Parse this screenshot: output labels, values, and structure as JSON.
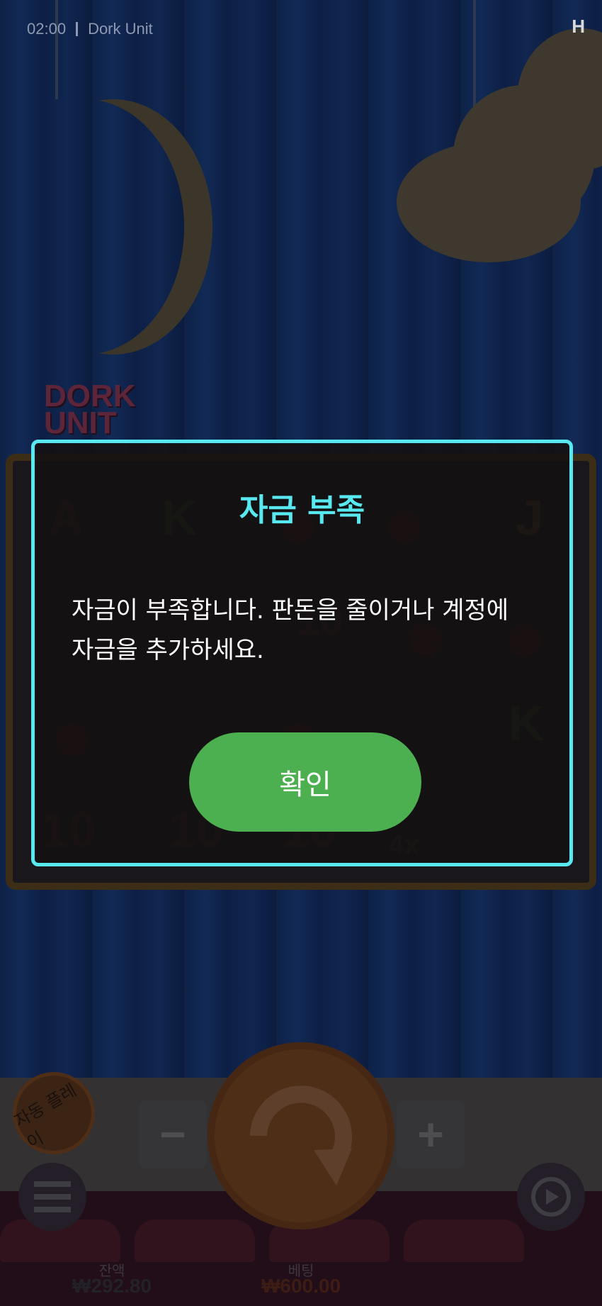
{
  "status_bar": {
    "time": "02:00",
    "game_name": "Dork Unit"
  },
  "game": {
    "logo_text": "DORK UNIT",
    "reel_symbols": [
      "A",
      "K",
      "J",
      "10",
      "K",
      "10",
      "10",
      "10",
      "4x"
    ]
  },
  "dialog": {
    "title": "자금 부족",
    "message": "자금이 부족합니다. 판돈을 줄이거나 계정에 자금을 추가하세요.",
    "ok_label": "확인"
  },
  "controls": {
    "autoplay_label": "자동 플레이",
    "minus_label": "−",
    "plus_label": "+"
  },
  "footer": {
    "balance_label": "잔액",
    "balance_value": "₩292.80",
    "bet_label": "베팅",
    "bet_value": "₩600.00",
    "balance_color": "#3d3436",
    "bet_color": "#6b2a10"
  },
  "colors": {
    "dialog_accent": "#58e8ef",
    "ok_button": "#4caf50"
  }
}
